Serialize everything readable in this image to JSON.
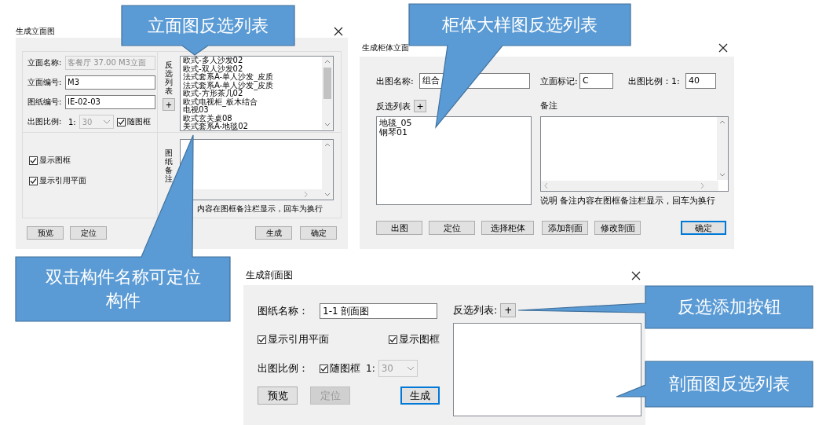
{
  "elevation_dialog": {
    "title": "生成立面图",
    "fields": [
      {
        "label": "立面名称:",
        "value": "客餐厅 37.00 M3立面",
        "disabled": true
      },
      {
        "label": "立面编号:",
        "value": "M3",
        "disabled": false
      },
      {
        "label": "图纸编号:",
        "value": "IE-02-03",
        "disabled": false
      }
    ],
    "scale": {
      "label": "出图比例:",
      "prefix": "1:",
      "value": "30",
      "disabled": true
    },
    "follow_frame": {
      "label": "随图框",
      "checked": true
    },
    "options": [
      {
        "label": "显示图框",
        "checked": true
      },
      {
        "label": "显示引用平面",
        "checked": true
      }
    ],
    "list_label": "反选列表",
    "add_button": "+",
    "list_items": [
      "欧式-多人沙发02",
      "欧式-双人沙发02",
      "法式套系A-单人沙发_皮质",
      "法式套系A-单人沙发_皮质",
      "欧式-方形茶几02",
      "欧式电视柜_板木结合",
      "电视03",
      "欧式玄关桌08",
      "美式套系A-地毯02"
    ],
    "notes_label": "图纸备注",
    "notes_hint": "内容在图框备注栏显示，回车为换行",
    "buttons_left": [
      {
        "label": "预览",
        "disabled": false,
        "default": false
      },
      {
        "label": "定位",
        "disabled": false,
        "default": false
      }
    ],
    "buttons_right": [
      {
        "label": "生成",
        "disabled": false,
        "default": false
      },
      {
        "label": "确定",
        "disabled": false,
        "default": false
      }
    ]
  },
  "cabinet_dialog": {
    "title": "生成柜体立面",
    "name_field": {
      "label": "出图名称:",
      "value": "组合"
    },
    "mark_field": {
      "label": "立面标记:",
      "value": "C"
    },
    "scale_field": {
      "label": "出图比例：1:",
      "value": "40"
    },
    "list_label": "反选列表",
    "add_button": "+",
    "list_items": [
      "地毯_05",
      "钢琴01"
    ],
    "notes_label": "备注",
    "notes_hint": "说明 备注内容在图框备注栏显示，回车为换行",
    "buttons_left": [
      {
        "label": "出图",
        "disabled": false,
        "default": false
      },
      {
        "label": "定位",
        "disabled": false,
        "default": false
      },
      {
        "label": "选择柜体",
        "disabled": false,
        "default": false
      },
      {
        "label": "添加剖面",
        "disabled": false,
        "default": false
      },
      {
        "label": "修改剖面",
        "disabled": false,
        "default": false
      }
    ],
    "buttons_right": [
      {
        "label": "确定",
        "disabled": false,
        "default": true
      }
    ]
  },
  "section_dialog": {
    "title": "生成剖面图",
    "name_field": {
      "label": "图纸名称：",
      "value": "1-1 剖面图"
    },
    "options": [
      {
        "label": "显示引用平面",
        "checked": true
      },
      {
        "label": "显示图框",
        "checked": true
      }
    ],
    "scale_label": "出图比例：",
    "follow_frame": {
      "label": "随图框",
      "checked": true
    },
    "scale": {
      "prefix": "1:",
      "value": "30",
      "disabled": true
    },
    "list_label": "反选列表:",
    "add_button": "+",
    "buttons_left": [
      {
        "label": "预览",
        "disabled": false,
        "default": false
      },
      {
        "label": "定位",
        "disabled": true,
        "default": false
      }
    ],
    "buttons_right": [
      {
        "label": "生成",
        "disabled": false,
        "default": true
      }
    ]
  },
  "callouts": [
    {
      "text": "立面图反选列表"
    },
    {
      "text": "柜体大样图反选列表"
    },
    {
      "text": "双击构件名称可定位构件"
    },
    {
      "text": "反选添加按钮"
    },
    {
      "text": "剖面图反选列表"
    }
  ]
}
